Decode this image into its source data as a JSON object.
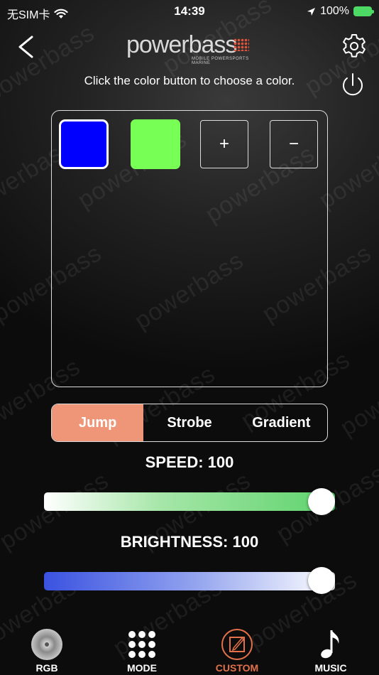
{
  "status_bar": {
    "carrier": "无SIM卡",
    "time": "14:39",
    "battery": "100%"
  },
  "header": {
    "logo_text": "powerbass",
    "logo_sub": "MOBILE POWERSPORTS MARINE",
    "instruction": "Click the color button to choose a color."
  },
  "colors": {
    "swatch_1": "#0000ff",
    "swatch_2": "#77ff55",
    "add_label": "+",
    "remove_label": "−",
    "accent": "#ef9679"
  },
  "modes": {
    "items": [
      "Jump",
      "Strobe",
      "Gradient"
    ],
    "active": "Jump"
  },
  "speed": {
    "label": "SPEED: 100",
    "value": 100
  },
  "brightness": {
    "label": "BRIGHTNESS: 100",
    "value": 100
  },
  "tabs": [
    {
      "label": "RGB",
      "icon": "rgb-disc-icon"
    },
    {
      "label": "MODE",
      "icon": "grid-dots-icon"
    },
    {
      "label": "CUSTOM",
      "icon": "edit-icon",
      "active": true
    },
    {
      "label": "MUSIC",
      "icon": "music-note-icon"
    }
  ]
}
